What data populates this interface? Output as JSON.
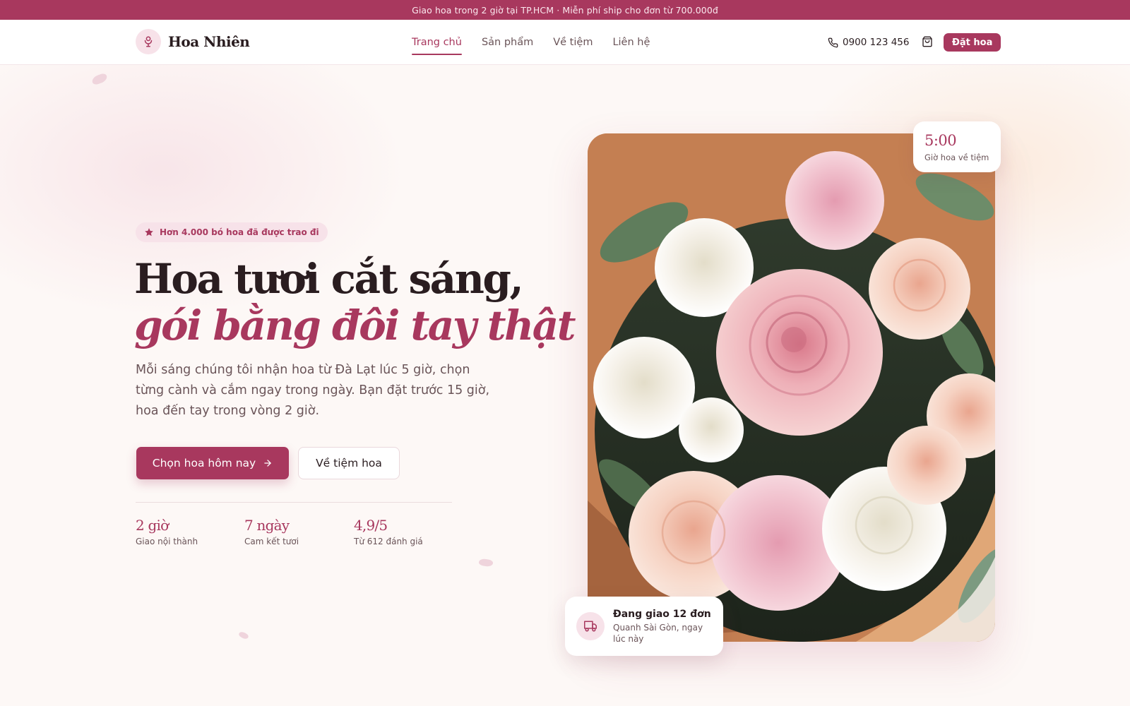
{
  "announcement": "Giao hoa trong 2 giờ tại TP.HCM · Miễn phí ship cho đơn từ 700.000đ",
  "brand": {
    "name": "Hoa Nhiên",
    "icon": "flower-icon"
  },
  "nav": {
    "items": [
      {
        "label": "Trang chủ",
        "active": true
      },
      {
        "label": "Sản phẩm",
        "active": false
      },
      {
        "label": "Về tiệm",
        "active": false
      },
      {
        "label": "Liên hệ",
        "active": false
      }
    ]
  },
  "header": {
    "phone": "0900 123 456",
    "phone_icon": "phone-icon",
    "cart_icon": "shopping-bag-icon",
    "order_label": "Đặt hoa"
  },
  "hero": {
    "badge": "Hơn 4.000 bó hoa đã được trao đi",
    "badge_icon": "star-icon",
    "title_line1": "Hoa tươi cắt sáng,",
    "title_line2": "gói bằng đôi tay thật",
    "description": "Mỗi sáng chúng tôi nhận hoa từ Đà Lạt lúc 5 giờ, chọn từng cành và cắm ngay trong ngày. Bạn đặt trước 15 giờ, hoa đến tay trong vòng 2 giờ.",
    "primary_cta": "Chọn hoa hôm nay",
    "secondary_cta": "Về tiệm hoa",
    "stats": [
      {
        "value": "2 giờ",
        "label": "Giao nội thành"
      },
      {
        "value": "7 ngày",
        "label": "Cam kết tươi"
      },
      {
        "value": "4,9/5",
        "label": "Từ 612 đánh giá"
      }
    ]
  },
  "time_card": {
    "value": "5:00",
    "label": "Giờ hoa về tiệm"
  },
  "delivery_card": {
    "title": "Đang giao 12 đơn",
    "subtitle": "Quanh Sài Gòn, ngay lúc này",
    "icon": "truck-icon"
  },
  "colors": {
    "accent": "#a8385e",
    "accent_soft": "#f7e2e9",
    "text": "#2a1d20",
    "muted": "#6a5458",
    "background": "#fdf8f6"
  }
}
